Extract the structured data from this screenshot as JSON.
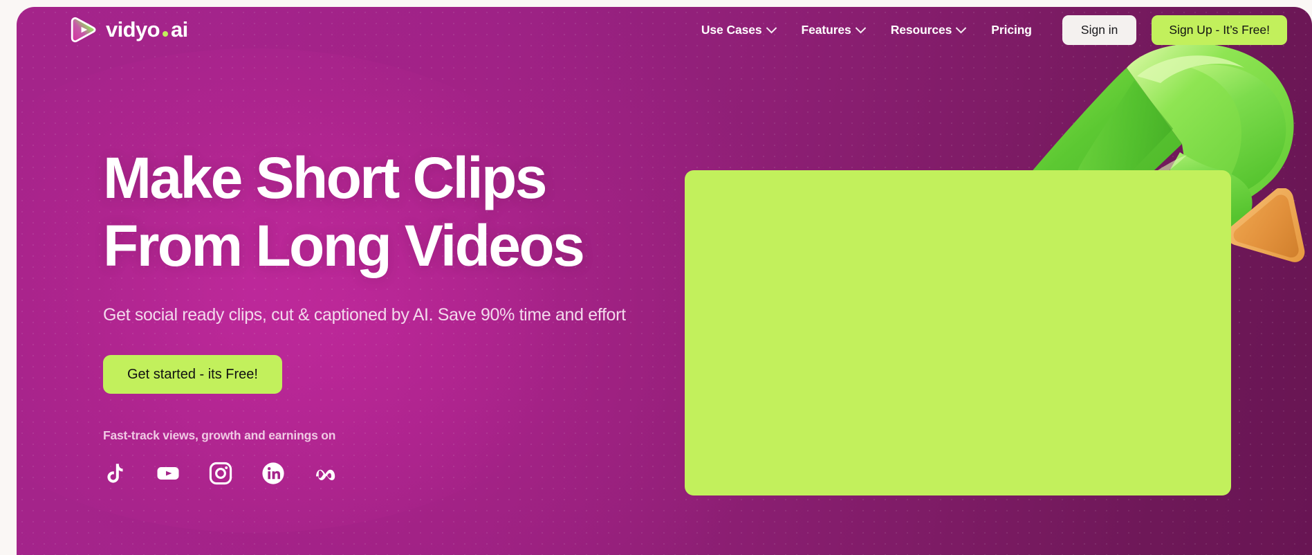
{
  "brand": {
    "name_part1": "vidyo",
    "name_part2": "ai",
    "logo_icon": "play-triangle-logo-icon",
    "dot_color": "#c2f05c"
  },
  "nav": {
    "links": [
      {
        "label": "Use Cases",
        "has_dropdown": true
      },
      {
        "label": "Features",
        "has_dropdown": true
      },
      {
        "label": "Resources",
        "has_dropdown": true
      },
      {
        "label": "Pricing",
        "has_dropdown": false
      }
    ],
    "sign_in_label": "Sign in",
    "sign_up_label": "Sign Up - It’s Free!"
  },
  "hero": {
    "headline_line1": "Make Short Clips",
    "headline_line2": "From Long Videos",
    "subheadline": "Get social ready clips, cut & captioned by AI. Save 90% time and effort",
    "cta_label": "Get started - its Free!",
    "social_proof_label": "Fast-track views, growth and earnings on",
    "social_icons": [
      {
        "name": "tiktok-icon",
        "label": "TikTok"
      },
      {
        "name": "youtube-icon",
        "label": "YouTube"
      },
      {
        "name": "instagram-icon",
        "label": "Instagram"
      },
      {
        "name": "linkedin-icon",
        "label": "LinkedIn"
      },
      {
        "name": "meta-icon",
        "label": "Meta"
      }
    ]
  },
  "media": {
    "video_placeholder_label": "",
    "video_placeholder_color": "#c2f05c"
  },
  "decor": {
    "green_shape": "green-3d-ribbon-shape",
    "orange_shape": "orange-3d-triangle-shape"
  },
  "theme": {
    "accent_green": "#c2f05c",
    "bg_magenta_left": "#a4248a",
    "bg_purple_right": "#681553",
    "page_bg": "#faf7f5"
  }
}
